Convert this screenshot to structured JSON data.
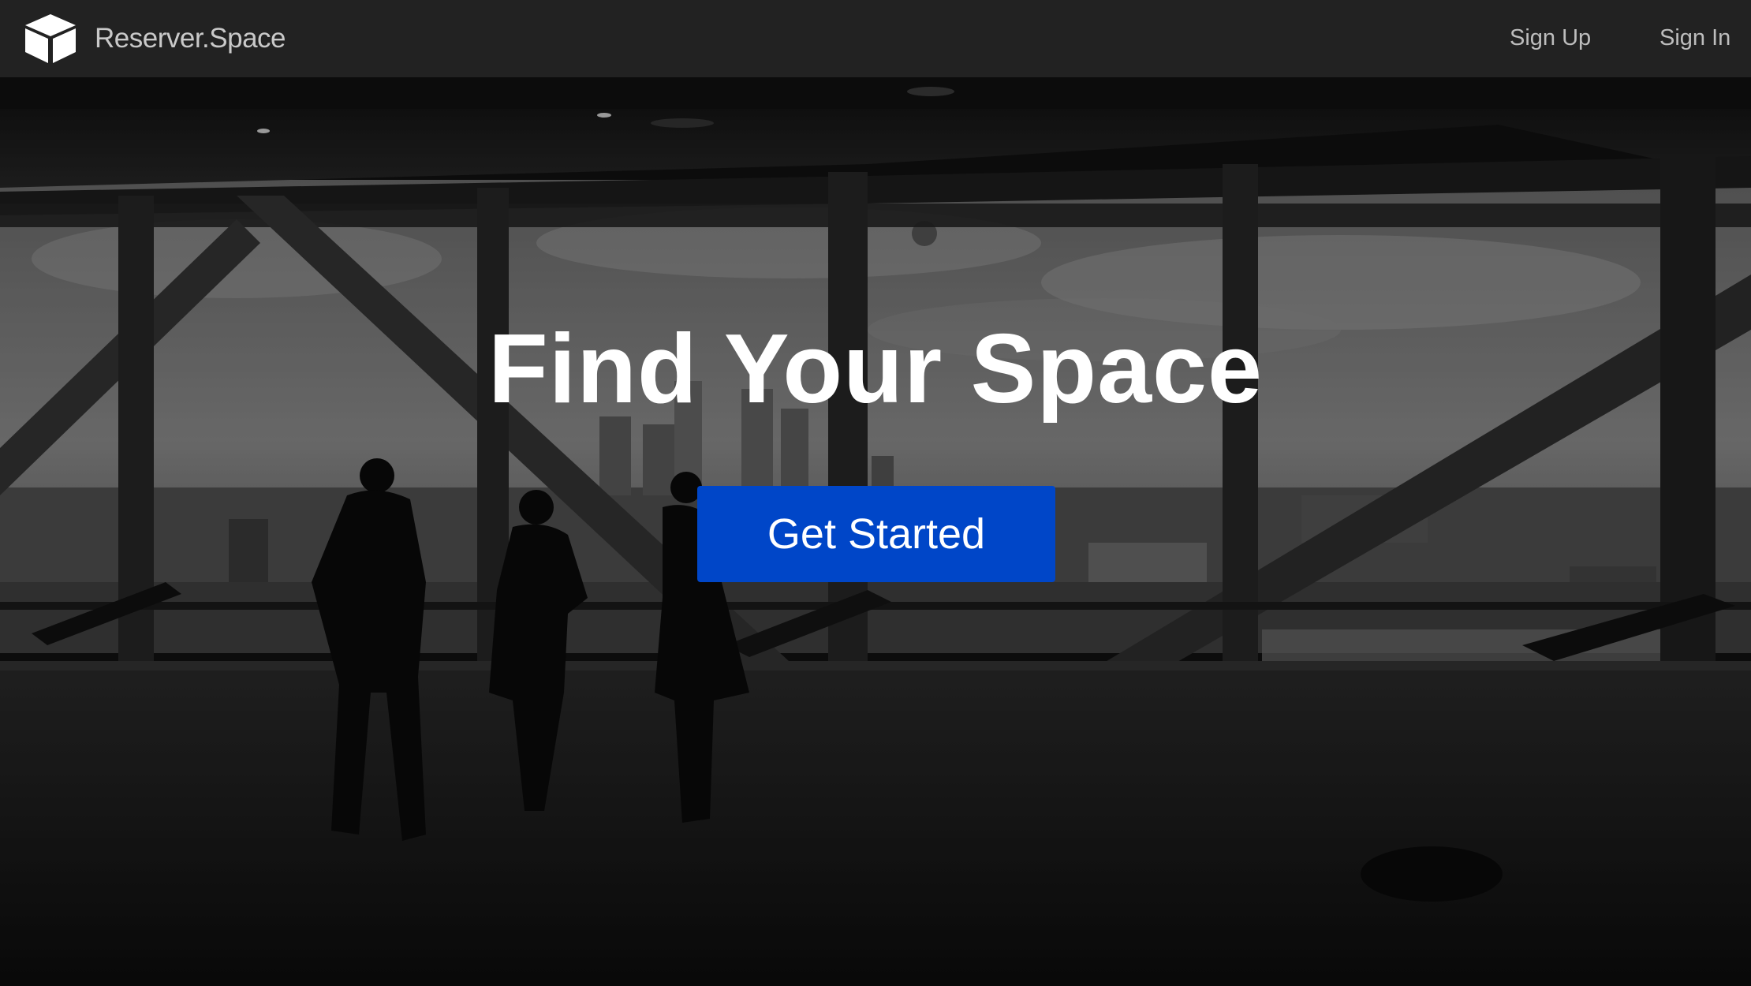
{
  "navbar": {
    "brand_name": "Reserver.Space",
    "links": {
      "sign_up": "Sign Up",
      "sign_in": "Sign In"
    }
  },
  "hero": {
    "title": "Find Your Space",
    "cta_label": "Get Started",
    "background_image": "black-and-white-office-interior-silhouettes-city-view"
  },
  "colors": {
    "navbar_bg": "#222222",
    "brand_text": "#c9c9c9",
    "nav_link_text": "#bdbdbd",
    "cta_bg": "#0046c8",
    "hero_title": "#ffffff"
  },
  "icons": {
    "brand_logo": "cube-icon"
  }
}
